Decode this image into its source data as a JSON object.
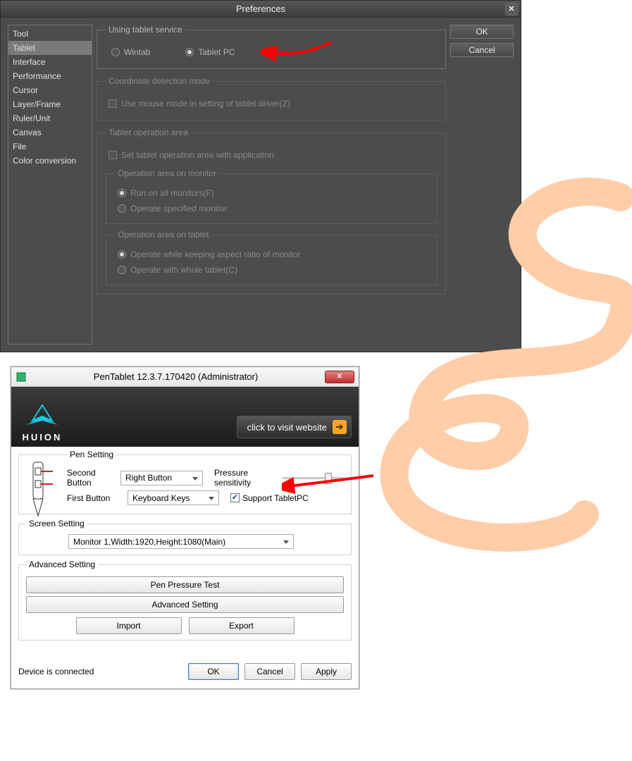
{
  "pref": {
    "title": "Preferences",
    "sidebar": [
      "Tool",
      "Tablet",
      "Interface",
      "Performance",
      "Cursor",
      "Layer/Frame",
      "Ruler/Unit",
      "Canvas",
      "File",
      "Color conversion"
    ],
    "sidebar_selected_index": 1,
    "ok": "OK",
    "cancel": "Cancel",
    "group_tablet_service": {
      "legend": "Using tablet service",
      "wintab": "Wintab",
      "tabletpc": "Tablet PC",
      "selected": "tabletpc"
    },
    "group_coord": {
      "legend": "Coordinate detection mode",
      "mouse_mode": "Use mouse mode in setting of tablet driver(Z)"
    },
    "group_oparea": {
      "legend": "Tablet operation area",
      "set_area": "Set tablet operation area with application",
      "monitor_legend": "Operation area on monitor",
      "run_all": "Run on all monitors(F)",
      "specified": "Operate specified monitor",
      "tablet_legend": "Operation area on tablet",
      "keep_ratio": "Operate while keeping aspect ratio of monitor",
      "whole_tablet": "Operate with whole tablet(C)"
    }
  },
  "huion": {
    "title": "PenTablet 12.3.7.170420 (Administrator)",
    "brand": "HUION",
    "visit": "click to visit website",
    "pen_legend": "Pen Setting",
    "second_button": "Second Button",
    "second_button_value": "Right Button",
    "first_button": "First Button",
    "first_button_value": "Keyboard Keys",
    "pressure": "Pressure sensitivity",
    "support_tabletpc": "Support TabletPC",
    "support_tabletpc_checked": true,
    "screen_legend": "Screen Setting",
    "monitor_value": "Monitor 1,Width:1920,Height:1080(Main)",
    "adv_legend": "Advanced Setting",
    "pen_test": "Pen Pressure Test",
    "adv_setting": "Advanced Setting",
    "import": "Import",
    "export": "Export",
    "device_status": "Device is connected",
    "ok": "OK",
    "cancel": "Cancel",
    "apply": "Apply"
  }
}
